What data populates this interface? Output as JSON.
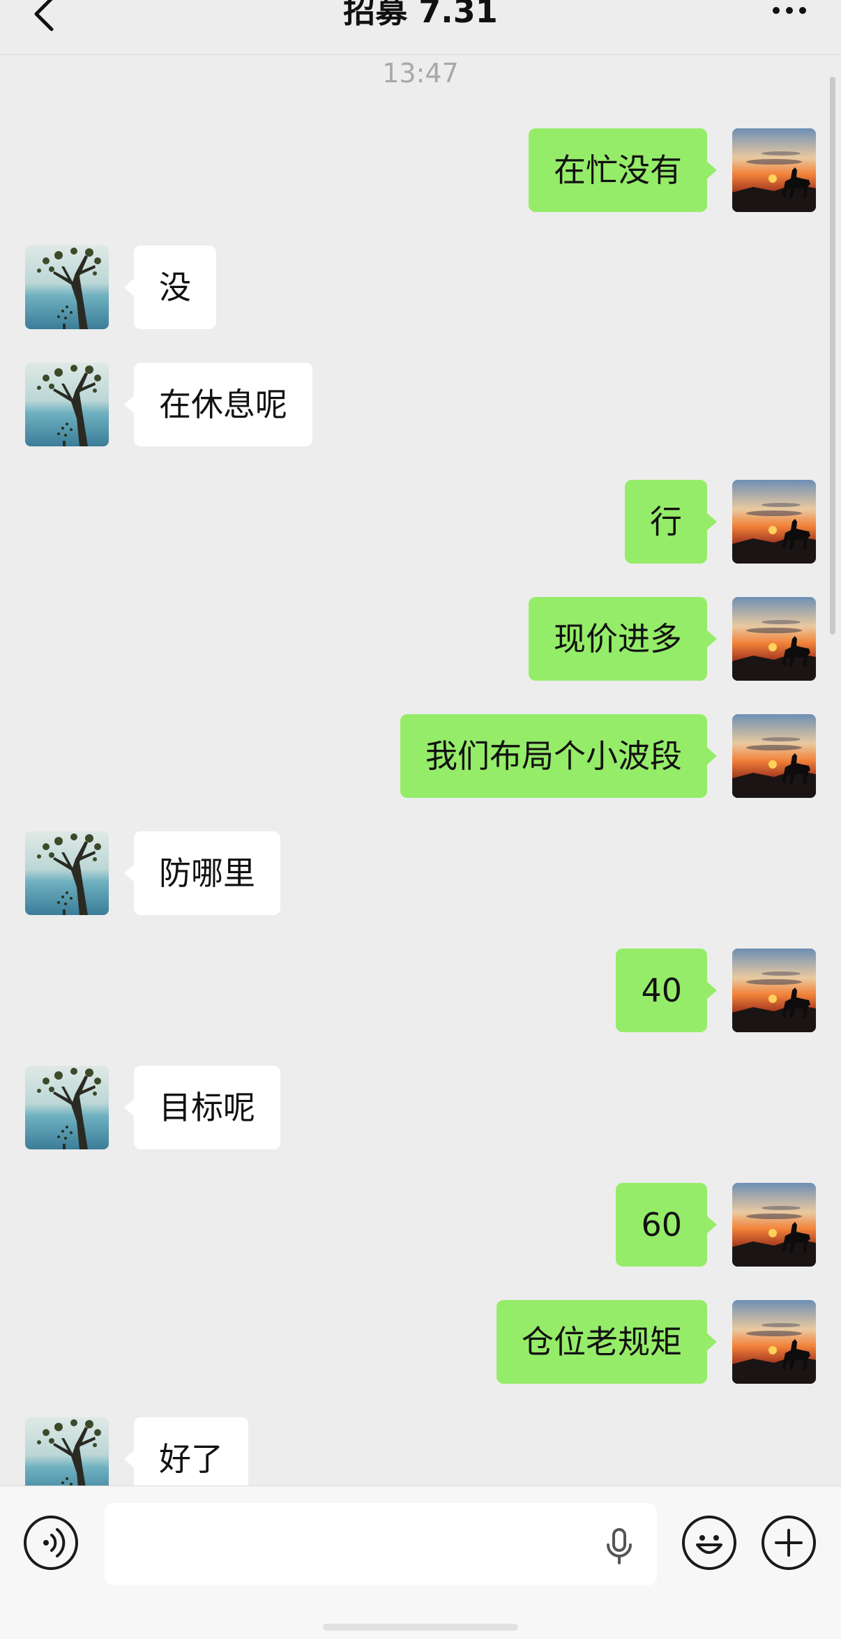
{
  "header": {
    "title": "招募 7.31",
    "back_icon": "chevron-left-icon",
    "more_icon": "more-dots-icon"
  },
  "chat": {
    "timestamp": "13:47",
    "messages": [
      {
        "side": "out",
        "text": "在忙没有"
      },
      {
        "side": "in",
        "text": "没"
      },
      {
        "side": "in",
        "text": "在休息呢"
      },
      {
        "side": "out",
        "text": "行"
      },
      {
        "side": "out",
        "text": "现价进多"
      },
      {
        "side": "out",
        "text": "我们布局个小波段"
      },
      {
        "side": "in",
        "text": "防哪里"
      },
      {
        "side": "out",
        "text": "40"
      },
      {
        "side": "in",
        "text": "目标呢"
      },
      {
        "side": "out",
        "text": "60"
      },
      {
        "side": "out",
        "text": "仓位老规矩"
      },
      {
        "side": "in",
        "text": "好了"
      }
    ]
  },
  "input_bar": {
    "voice_icon": "voice-icon",
    "text_value": "",
    "mic_icon": "microphone-icon",
    "emoji_icon": "emoji-icon",
    "plus_icon": "plus-icon"
  },
  "colors": {
    "background": "#ededed",
    "outgoing_bubble": "#95ec69",
    "incoming_bubble": "#ffffff",
    "timestamp_text": "#a8a8a8"
  }
}
